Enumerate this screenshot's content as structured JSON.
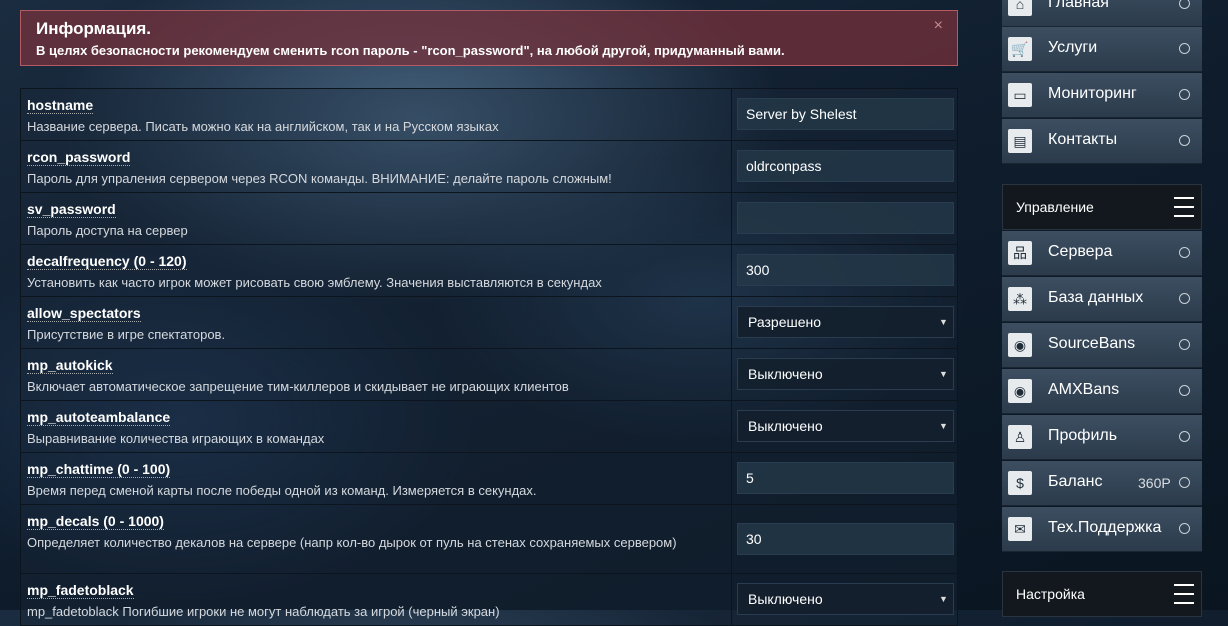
{
  "alert": {
    "title": "Информация.",
    "text": "В целях безопасности рекомендуем сменить rcon пароль - \"rcon_password\", на любой другой, придуманный вами.",
    "close": "×"
  },
  "settings": [
    {
      "name": "hostname",
      "desc": "Название сервера. Писать можно как на английском, так и на Русском языках",
      "type": "input",
      "value": "Server by Shelest"
    },
    {
      "name": "rcon_password",
      "desc": "Пароль для упраления сервером через RCON команды. ВНИМАНИЕ: делайте пароль сложным!",
      "type": "input",
      "value": "oldrconpass"
    },
    {
      "name": "sv_password",
      "desc": "Пароль доступа на сервер",
      "type": "input",
      "value": ""
    },
    {
      "name": "decalfrequency (0 - 120)",
      "desc": "Установить как часто игрок может рисовать свою эмблему. Значения выставляются в секундах",
      "type": "input",
      "value": "300"
    },
    {
      "name": "allow_spectators",
      "desc": "Присутствие в игре спектаторов.",
      "type": "select",
      "value": "Разрешено"
    },
    {
      "name": "mp_autokick",
      "desc": "Включает автоматическое запрещение тим-киллеров и скидывает не играющих клиентов",
      "type": "select",
      "value": "Выключено"
    },
    {
      "name": "mp_autoteambalance",
      "desc": "Выравнивание количества играющих в командах",
      "type": "select",
      "value": "Выключено"
    },
    {
      "name": "mp_chattime (0 - 100)",
      "desc": "Время перед сменой карты после победы одной из команд. Измеряется в секундах.",
      "type": "input",
      "value": "5"
    },
    {
      "name": "mp_decals (0 - 1000)",
      "desc": "Определяет количество декалов на сервере (напр кол-во дырок от пуль на стенах сохраняемых сервером)",
      "type": "input",
      "value": "30"
    },
    {
      "name": "mp_fadetoblack",
      "desc": "mp_fadetoblack Погибшие игроки не могут наблюдать за игрой (черный экран)",
      "type": "select",
      "value": "Выключено"
    }
  ],
  "sidebar": {
    "top_items": [
      {
        "label": "Главная",
        "icon": "home-icon",
        "glyph": "⌂"
      },
      {
        "label": "Услуги",
        "icon": "cart-icon",
        "glyph": "🛒"
      },
      {
        "label": "Мониторинг",
        "icon": "monitor-icon",
        "glyph": "▭"
      },
      {
        "label": "Контакты",
        "icon": "contacts-icon",
        "glyph": "▤"
      }
    ],
    "manage_title": "Управление",
    "manage_items": [
      {
        "label": "Сервера",
        "icon": "servers-icon",
        "glyph": "品",
        "extra": ""
      },
      {
        "label": "База данных",
        "icon": "database-icon",
        "glyph": "⁂",
        "extra": ""
      },
      {
        "label": "SourceBans",
        "icon": "sourcebans-icon",
        "glyph": "◉",
        "extra": ""
      },
      {
        "label": "AMXBans",
        "icon": "amxbans-icon",
        "glyph": "◉",
        "extra": ""
      },
      {
        "label": "Профиль",
        "icon": "profile-icon",
        "glyph": "♙",
        "extra": ""
      },
      {
        "label": "Баланс",
        "icon": "balance-icon",
        "glyph": "$",
        "extra": "360Р"
      },
      {
        "label": "Тех.Поддержка",
        "icon": "support-icon",
        "glyph": "✉",
        "extra": ""
      }
    ],
    "settings_title": "Настройка"
  }
}
